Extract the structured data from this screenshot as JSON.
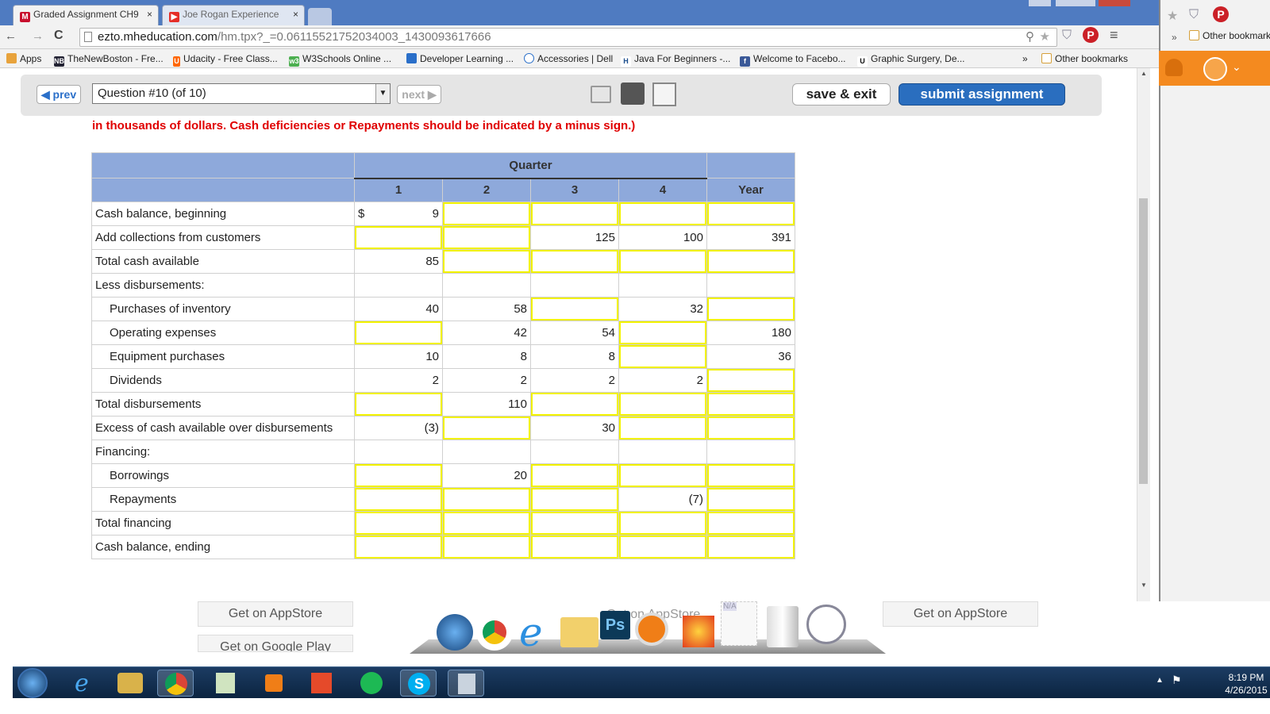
{
  "browser": {
    "tabs": [
      {
        "label": "Graded Assignment CH9",
        "close": "×"
      },
      {
        "label": "Joe Rogan Experience",
        "close": "×"
      }
    ],
    "url_host": "ezto.mheducation.com",
    "url_path": "/hm.tpx?_=0.06115521752034003_1430093617666",
    "bookmarks": [
      "Apps",
      "TheNewBoston - Fre...",
      "Udacity - Free Class...",
      "W3Schools Online ...",
      "Developer Learning ...",
      "Accessories | Dell",
      "Java For Beginners -...",
      "Welcome to Facebo...",
      "Graphic Surgery, De...",
      "»",
      "Other bookmarks"
    ],
    "right_other_bookmarks": "Other bookmarks"
  },
  "assignment_nav": {
    "prev_label": "prev",
    "question_select": "Question #10 (of 10)",
    "next_label": "next",
    "save_exit_label": "save & exit",
    "submit_label": "submit assignment"
  },
  "instruction": "in thousands of dollars. Cash deficiencies or Repayments should be indicated by a minus sign.)",
  "table": {
    "group_header": "Quarter",
    "col_headers": [
      "1",
      "2",
      "3",
      "4",
      "Year"
    ],
    "rows": [
      {
        "label": "Cash balance, beginning",
        "cells": [
          "9",
          "",
          "",
          "",
          ""
        ],
        "currency": "$"
      },
      {
        "label": "Add collections from customers",
        "cells": [
          "",
          "",
          "125",
          "100",
          "391"
        ]
      },
      {
        "label": "Total cash available",
        "cells": [
          "85",
          "",
          "",
          "",
          ""
        ]
      },
      {
        "label": "Less disbursements:",
        "cells": [
          "",
          "",
          "",
          "",
          ""
        ]
      },
      {
        "label": "Purchases of inventory",
        "cells": [
          "40",
          "58",
          "",
          "32",
          ""
        ]
      },
      {
        "label": "Operating expenses",
        "cells": [
          "",
          "42",
          "54",
          "",
          "180"
        ]
      },
      {
        "label": "Equipment purchases",
        "cells": [
          "10",
          "8",
          "8",
          "",
          "36"
        ]
      },
      {
        "label": "Dividends",
        "cells": [
          "2",
          "2",
          "2",
          "2",
          ""
        ]
      },
      {
        "label": "Total disbursements",
        "cells": [
          "",
          "110",
          "",
          "",
          ""
        ]
      },
      {
        "label": "Excess of cash available over disbursements",
        "cells": [
          "(3)",
          "",
          "30",
          "",
          ""
        ]
      },
      {
        "label": "Financing:",
        "cells": [
          "",
          "",
          "",
          "",
          ""
        ]
      },
      {
        "label": "Borrowings",
        "cells": [
          "",
          "20",
          "",
          "",
          ""
        ]
      },
      {
        "label": "Repayments",
        "cells": [
          "",
          "",
          "",
          "(7)",
          ""
        ]
      },
      {
        "label": "Total financing",
        "cells": [
          "",
          "",
          "",
          "",
          ""
        ]
      },
      {
        "label": "Cash balance, ending",
        "cells": [
          "",
          "",
          "",
          "",
          ""
        ]
      }
    ]
  },
  "dock": {
    "store_left_1": "Get on AppStore",
    "store_left_2": "Get on Google Play",
    "store_right": "Get on AppStore",
    "dock_faded_text": "Get on AppStore",
    "na_label": "N/A"
  },
  "taskbar": {
    "time": "8:19 PM",
    "date": "4/26/2015"
  }
}
